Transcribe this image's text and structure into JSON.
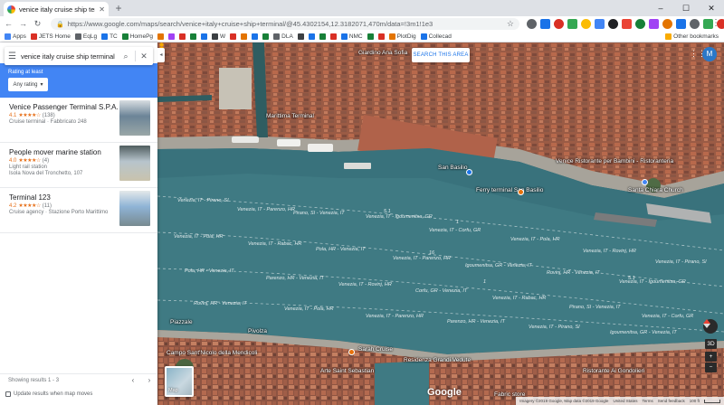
{
  "browser": {
    "tab_title": "venice italy cruise ship terminal",
    "url": "https://www.google.com/maps/search/venice+italy+cruise+ship+terminal/@45.4302154,12.3182071,470m/data=!3m1!1e3",
    "window_controls": [
      "–",
      "☐",
      "✕"
    ]
  },
  "bookmarks": {
    "items": [
      {
        "label": "Apps",
        "color": "#4285f4"
      },
      {
        "label": "JETS Home",
        "color": "#d93025"
      },
      {
        "label": "EqLg",
        "color": "#5f6368"
      },
      {
        "label": "TC",
        "color": "#1a73e8"
      },
      {
        "label": "HomePg",
        "color": "#188038"
      },
      {
        "label": "",
        "color": "#e37400"
      },
      {
        "label": "",
        "color": "#a142f4"
      },
      {
        "label": "",
        "color": "#d93025"
      },
      {
        "label": "",
        "color": "#188038"
      },
      {
        "label": "",
        "color": "#1a73e8"
      },
      {
        "label": "W",
        "color": "#3c4043"
      },
      {
        "label": "",
        "color": "#d93025"
      },
      {
        "label": "",
        "color": "#e37400"
      },
      {
        "label": "",
        "color": "#1a73e8"
      },
      {
        "label": "",
        "color": "#188038"
      },
      {
        "label": "DLA",
        "color": "#5f6368"
      },
      {
        "label": "",
        "color": "#3c4043"
      },
      {
        "label": "",
        "color": "#1a73e8"
      },
      {
        "label": "",
        "color": "#188038"
      },
      {
        "label": "",
        "color": "#d93025"
      },
      {
        "label": "NMC",
        "color": "#1a73e8"
      },
      {
        "label": "",
        "color": "#188038"
      },
      {
        "label": "",
        "color": "#d93025"
      },
      {
        "label": "PlotDig",
        "color": "#e37400"
      },
      {
        "label": "Collecad",
        "color": "#1a73e8"
      }
    ],
    "other_label": "Other bookmarks"
  },
  "sidebar": {
    "search_value": "venice italy cruise ship terminal",
    "filter_label": "Rating at least",
    "filter_button": "Any rating",
    "results": [
      {
        "name": "Venice Passenger Terminal S.P.A.",
        "rating": "4.1",
        "stars": "★★★★☆",
        "reviews": "(138)",
        "category": "Cruise terminal · Fabbricato 248",
        "address": "",
        "thumb_colors": [
          "#6c8497",
          "#d7dde1",
          "#9aa7a7"
        ]
      },
      {
        "name": "People mover marine station",
        "rating": "4.0",
        "stars": "★★★★☆",
        "reviews": "(4)",
        "category": "Light rail station",
        "address": "Isola Nova del Tronchetto, 107",
        "thumb_colors": [
          "#b7c4cc",
          "#4f5d5f",
          "#c9c3ad"
        ]
      },
      {
        "name": "Terminal 123",
        "rating": "4.2",
        "stars": "★★★★☆",
        "reviews": "(11)",
        "category": "Cruise agency · Stazione Porto Marittimo",
        "address": "",
        "thumb_colors": [
          "#8fb4d6",
          "#e4e8ea",
          "#788a90"
        ]
      }
    ],
    "pager_text": "Showing results 1 - 3",
    "update_label": "Update results when map moves"
  },
  "map": {
    "search_area_button": "SEARCH THIS AREA",
    "avatar_letter": "M",
    "minimap_label": "Map",
    "logo": "Google",
    "ctrl_3d": "3D",
    "zoom_in": "+",
    "zoom_out": "−",
    "place_labels": [
      "Giardino Ana Sofia",
      "Marittima Terminal",
      "San Basilio",
      "Venice Ristorante per Bambini - Ristoranteria",
      "Ferry terminal San Basilio",
      "Santa Chiara Church",
      "Piazzale",
      "Sarah Cruise",
      "Residenza Grandi Vedute",
      "Fabric store",
      "Pivolza",
      "Ristorante Ai Gondolieri",
      "Arte Saint Sebastian",
      "Campo Sant'Nicolo della Mendicoli"
    ],
    "route_labels": [
      "Venezia, IT - Pirano, SI",
      "Venezia, IT - Pola, HR",
      "Venezia, IT - Parenzo, HR",
      "Venezia, IT - Rovinj, HR",
      "Venezia, IT - Rabac, HR",
      "Venezia, IT - Igoumenitsa, GR",
      "Venezia, IT - Corfu, GR",
      "Pola, HR - Venezia, IT",
      "Rovinj, HR - Venezia, IT",
      "Parenzo, HR - Venezia, IT",
      "Pirano, SI - Venezia, IT",
      "Igoumenitsa, GR - Venezia, IT",
      "Corfu, GR - Venezia, IT"
    ],
    "route_numbers": [
      "1",
      "5.1",
      "16"
    ],
    "footer": {
      "imagery": "Imagery ©2019 Google, Map data ©2019 Google",
      "united_states": "United States",
      "terms": "Terms",
      "feedback": "Send feedback",
      "scale": "100 ft"
    }
  }
}
